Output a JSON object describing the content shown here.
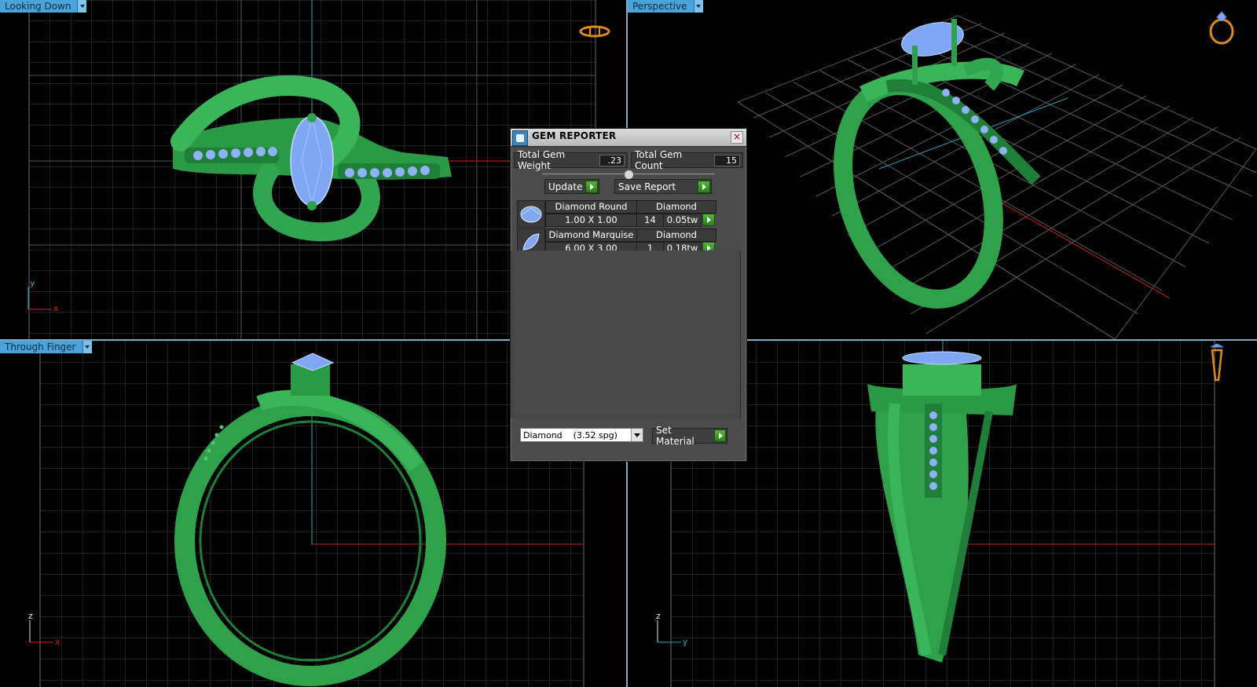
{
  "viewports": {
    "top_left": {
      "label": "Looking Down"
    },
    "top_right": {
      "label": "Perspective"
    },
    "bottom_left": {
      "label": "Through Finger"
    },
    "bottom_right": {
      "label": ""
    }
  },
  "axes": {
    "top_left": {
      "v": "y",
      "h": "x"
    },
    "bottom_left": {
      "v": "z",
      "h": "x"
    },
    "bottom_right": {
      "v": "z",
      "h": "y"
    }
  },
  "gem_reporter": {
    "title": "GEM REPORTER",
    "close_symbol": "×",
    "total_weight_label": "Total Gem Weight",
    "total_weight_value": ".23",
    "total_count_label": "Total Gem Count",
    "total_count_value": "15",
    "update_label": "Update",
    "save_report_label": "Save Report",
    "gems": [
      {
        "name": "Diamond Round",
        "material": "Diamond",
        "size": "1.00 X 1.00",
        "count": "14",
        "weight": "0.05tw"
      },
      {
        "name": "Diamond Marquise",
        "material": "Diamond",
        "size": "6.00 X 3.00",
        "count": "1",
        "weight": "0.18tw"
      }
    ],
    "material_select_value": "Diamond    (3.52 spg)",
    "set_material_label": "Set Material"
  },
  "colors": {
    "metal": "#2fa14b",
    "gem": "#7fa7f3",
    "grid": "#3c3c3c",
    "axis_x": "#d21f1f",
    "axis_y": "#2aa6c9",
    "viewport_label": "#4aa3d9"
  },
  "icons": [
    "ring-orientation-icon",
    "app-icon",
    "close-icon",
    "dropdown-icon",
    "go-arrow-icon"
  ]
}
